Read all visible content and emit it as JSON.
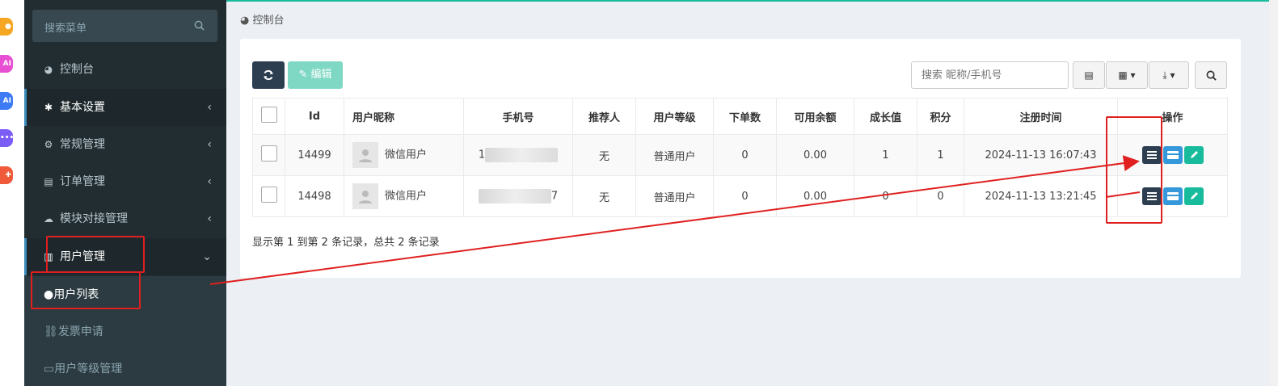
{
  "sidebar": {
    "search_placeholder": "搜索菜单",
    "items": [
      {
        "label": "控制台"
      },
      {
        "label": "基本设置"
      },
      {
        "label": "常规管理"
      },
      {
        "label": "订单管理"
      },
      {
        "label": "模块对接管理"
      },
      {
        "label": "用户管理"
      }
    ],
    "subitems": [
      {
        "label": "用户列表"
      },
      {
        "label": "发票申请"
      },
      {
        "label": "用户等级管理"
      }
    ],
    "caret_collapsed": "‹",
    "caret_expanded": "⌄"
  },
  "breadcrumb": "控制台",
  "toolbar": {
    "edit_label": "编辑",
    "search_placeholder": "搜索 昵称/手机号"
  },
  "table": {
    "headers": [
      "Id",
      "用户昵称",
      "手机号",
      "推荐人",
      "用户等级",
      "下单数",
      "可用余额",
      "成长值",
      "积分",
      "注册时间",
      "操作"
    ],
    "rows": [
      {
        "id": "14499",
        "nickname": "微信用户",
        "phone": "1",
        "referrer": "无",
        "level": "普通用户",
        "orders": "0",
        "balance": "0.00",
        "growth": "1",
        "points": "1",
        "registered": "2024-11-13 16:07:43"
      },
      {
        "id": "14498",
        "nickname": "微信用户",
        "phone": "7",
        "referrer": "无",
        "level": "普通用户",
        "orders": "0",
        "balance": "0.00",
        "growth": "0",
        "points": "0",
        "registered": "2024-11-13 13:21:45"
      }
    ]
  },
  "summary": "显示第 1 到第 2 条记录，总共 2 条记录",
  "colors": {
    "sidebar_bg": "#222d32",
    "accent_teal": "#18bc9c",
    "dark_button": "#2c3e50",
    "blue_button": "#3498db",
    "annotation_red": "#e02020"
  }
}
